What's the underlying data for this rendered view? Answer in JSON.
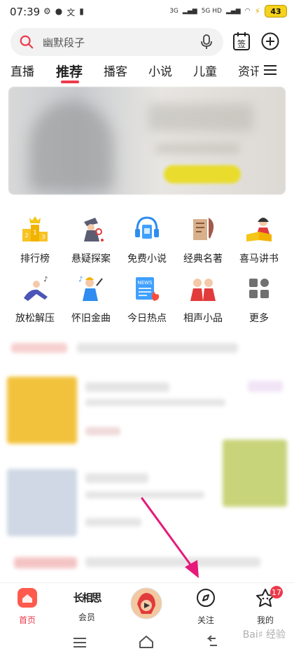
{
  "status": {
    "time": "07:39",
    "net1": "3G",
    "net2": "5G HD",
    "battery": "43"
  },
  "search": {
    "placeholder": "幽默段子",
    "calendar_label": "签"
  },
  "tabs": [
    {
      "label": "直播"
    },
    {
      "label": "推荐"
    },
    {
      "label": "播客"
    },
    {
      "label": "小说"
    },
    {
      "label": "儿童"
    },
    {
      "label": "资讯"
    }
  ],
  "categories": [
    {
      "label": "排行榜",
      "icon": "podium-icon"
    },
    {
      "label": "悬疑探案",
      "icon": "detective-icon"
    },
    {
      "label": "免费小说",
      "icon": "headphone-book-icon"
    },
    {
      "label": "经典名著",
      "icon": "quill-scroll-icon"
    },
    {
      "label": "喜马讲书",
      "icon": "teacher-icon"
    },
    {
      "label": "放松解压",
      "icon": "relax-icon"
    },
    {
      "label": "怀旧金曲",
      "icon": "singer-icon"
    },
    {
      "label": "今日热点",
      "icon": "news-icon"
    },
    {
      "label": "相声小品",
      "icon": "comedy-icon"
    },
    {
      "label": "更多",
      "icon": "more-grid-icon"
    }
  ],
  "nav": [
    {
      "label": "首页",
      "icon": "home-icon"
    },
    {
      "label": "会员",
      "icon": "vip-icon"
    },
    {
      "label": "",
      "icon": "center-cover-icon"
    },
    {
      "label": "关注",
      "icon": "compass-icon"
    },
    {
      "label": "我的",
      "icon": "star-face-icon"
    }
  ],
  "badge_count": "17",
  "vip_logo_text": "长相思",
  "colors": {
    "accent": "#ec3a4a",
    "arrow": "#e6197a"
  }
}
